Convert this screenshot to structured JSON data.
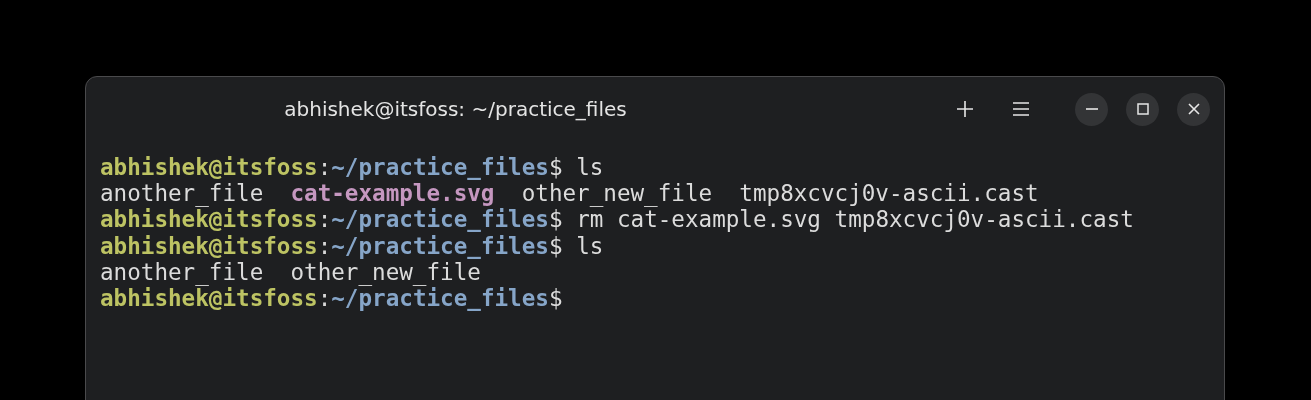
{
  "window": {
    "title": "abhishek@itsfoss: ~/practice_files"
  },
  "terminal": {
    "lines": [
      [
        {
          "kind": "user",
          "text": "abhishek@itsfoss"
        },
        {
          "kind": "colon",
          "text": ":"
        },
        {
          "kind": "path",
          "text": "~/practice_files"
        },
        {
          "kind": "plain",
          "text": "$ ls"
        }
      ],
      [
        {
          "kind": "plain",
          "text": "another_file  "
        },
        {
          "kind": "image",
          "text": "cat-example.svg"
        },
        {
          "kind": "plain",
          "text": "  other_new_file  tmp8xcvcj0v-ascii.cast"
        }
      ],
      [
        {
          "kind": "user",
          "text": "abhishek@itsfoss"
        },
        {
          "kind": "colon",
          "text": ":"
        },
        {
          "kind": "path",
          "text": "~/practice_files"
        },
        {
          "kind": "plain",
          "text": "$ rm cat-example.svg tmp8xcvcj0v-ascii.cast"
        }
      ],
      [
        {
          "kind": "user",
          "text": "abhishek@itsfoss"
        },
        {
          "kind": "colon",
          "text": ":"
        },
        {
          "kind": "path",
          "text": "~/practice_files"
        },
        {
          "kind": "plain",
          "text": "$ ls"
        }
      ],
      [
        {
          "kind": "plain",
          "text": "another_file  other_new_file"
        }
      ],
      [
        {
          "kind": "user",
          "text": "abhishek@itsfoss"
        },
        {
          "kind": "colon",
          "text": ":"
        },
        {
          "kind": "path",
          "text": "~/practice_files"
        },
        {
          "kind": "plain",
          "text": "$"
        }
      ]
    ]
  }
}
